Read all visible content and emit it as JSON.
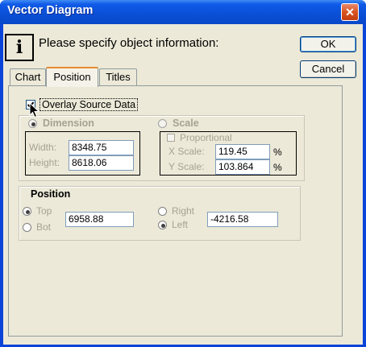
{
  "window": {
    "title": "Vector Diagram",
    "close_glyph": "✕"
  },
  "header": {
    "info_glyph": "i",
    "prompt": "Please specify object information:"
  },
  "buttons": {
    "ok": "OK",
    "cancel": "Cancel"
  },
  "tabs": [
    {
      "label": "Chart",
      "selected": false
    },
    {
      "label": "Position",
      "selected": true
    },
    {
      "label": "Titles",
      "selected": false
    }
  ],
  "overlay": {
    "label": "Overlay Source Data",
    "checked": true
  },
  "dimension": {
    "label": "Dimension",
    "selected": true,
    "width_label": "Width:",
    "width_value": "8348.75",
    "height_label": "Height:",
    "height_value": "8618.06"
  },
  "scale": {
    "label": "Scale",
    "selected": false,
    "proportional_label": "Proportional",
    "proportional_checked": false,
    "x_label": "X Scale:",
    "x_value": "119.45",
    "x_unit": "%",
    "y_label": "Y Scale:",
    "y_value": "103.864",
    "y_unit": "%"
  },
  "position": {
    "title": "Position",
    "top_label": "Top",
    "top_selected": true,
    "bot_label": "Bot",
    "bot_selected": false,
    "vertical_value": "6958.88",
    "right_label": "Right",
    "right_selected": false,
    "left_label": "Left",
    "left_selected": true,
    "horizontal_value": "-4216.58"
  },
  "icons": {
    "info": "info-icon",
    "cursor": "mouse-pointer-icon",
    "close": "close-icon"
  },
  "colors": {
    "titlebar": "#0a4fd6",
    "face": "#ece9d8",
    "active_tab_accent": "#e68b2c",
    "field_border": "#7f9db9"
  }
}
